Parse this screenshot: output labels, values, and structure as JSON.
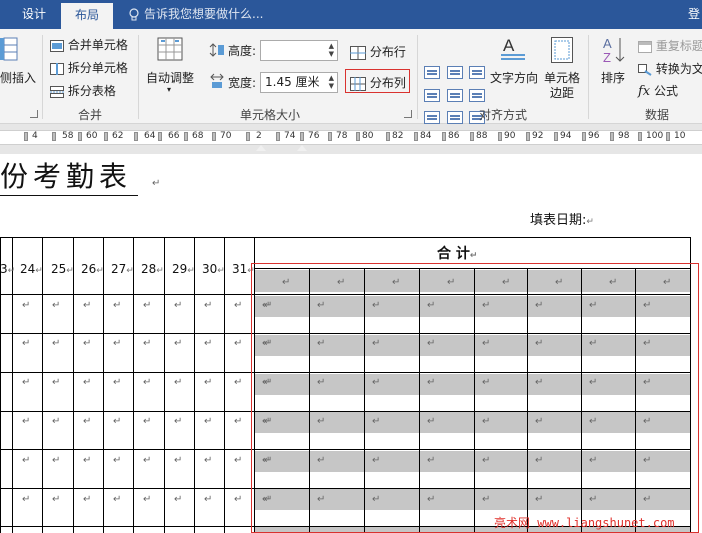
{
  "tabs": [
    "设计",
    "布局"
  ],
  "tell_me": "告诉我您想要做什么...",
  "signin": "登",
  "ribbon": {
    "insert_partial": "侧插入",
    "merge": {
      "merge_cells": "合并单元格",
      "split_cells": "拆分单元格",
      "split_table": "拆分表格",
      "label": "合并"
    },
    "cell_size": {
      "autofit": "自动调整",
      "height_label": "高度:",
      "height_value": "",
      "width_label": "宽度:",
      "width_value": "1.45 厘米",
      "distribute_rows": "分布行",
      "distribute_cols": "分布列",
      "label": "单元格大小"
    },
    "alignment": {
      "text_direction": "文字方向",
      "cell_margins_line1": "单元格",
      "cell_margins_line2": "边距",
      "label": "对齐方式"
    },
    "data": {
      "sort": "排序",
      "repeat_header": "重复标题",
      "convert_to_text": "转换为文",
      "formula": "公式",
      "label": "数据"
    }
  },
  "ruler_numbers": [
    "4",
    "58",
    "60",
    "62",
    "64",
    "66",
    "68",
    "70",
    "2",
    "74",
    "76",
    "78",
    "80",
    "82",
    "84",
    "86",
    "88",
    "90",
    "92",
    "94",
    "96",
    "98",
    "100",
    "10"
  ],
  "document": {
    "title": "份考勤表",
    "date_label": "填表日期:",
    "day_headers": [
      "3",
      "24",
      "25",
      "26",
      "27",
      "28",
      "29",
      "30",
      "31"
    ],
    "summary_header": "合     计",
    "paragraph_mark": "↵"
  },
  "watermark": {
    "cn": "亮术网",
    "url": "www.liangshunet.com"
  },
  "colors": {
    "title_bar": "#2b579a",
    "ribbon_bg": "#f3f3f3",
    "highlight_border": "#d9322f",
    "shade": "#c6c6c6"
  }
}
